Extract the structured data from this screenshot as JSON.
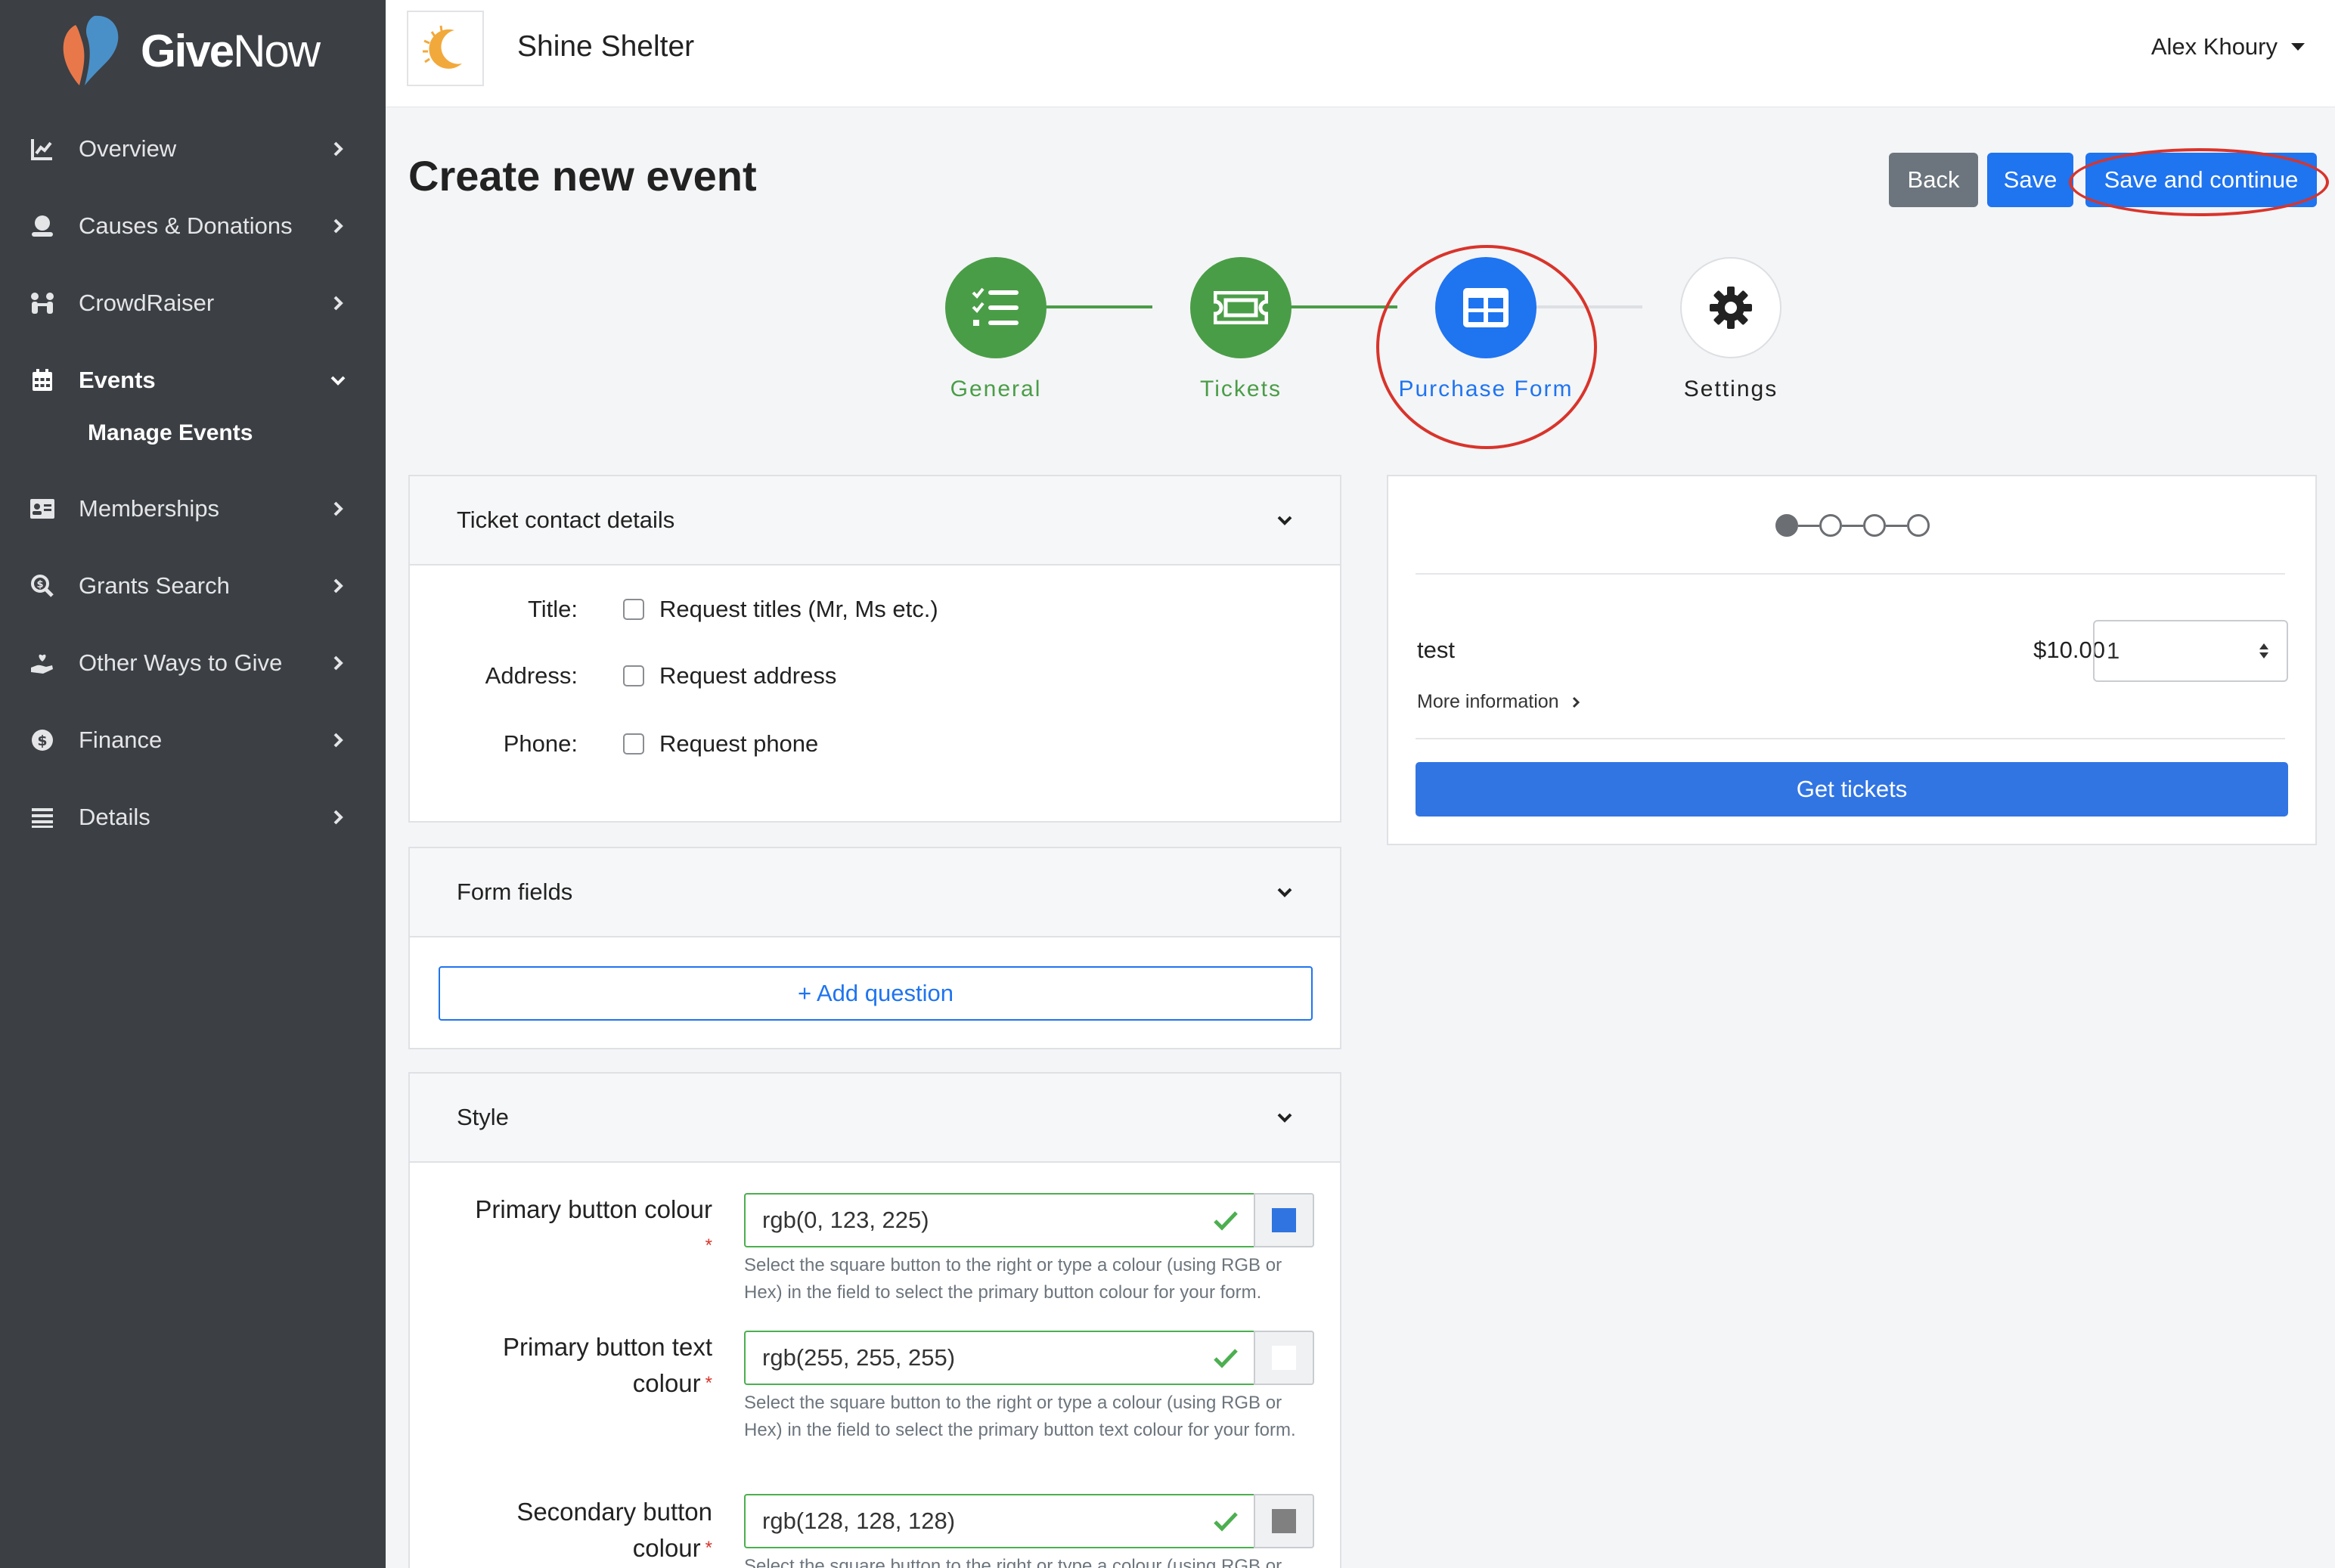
{
  "brand": {
    "logo_text_bold": "Give",
    "logo_text_light": "Now"
  },
  "sidebar": {
    "items": [
      {
        "label": "Overview",
        "icon": "chart-line-icon"
      },
      {
        "label": "Causes & Donations",
        "icon": "donation-icon"
      },
      {
        "label": "CrowdRaiser",
        "icon": "people-icon"
      },
      {
        "label": "Events",
        "icon": "calendar-icon",
        "expanded": true
      },
      {
        "label": "Memberships",
        "icon": "id-card-icon"
      },
      {
        "label": "Grants Search",
        "icon": "search-dollar-icon"
      },
      {
        "label": "Other Ways to Give",
        "icon": "hand-heart-icon"
      },
      {
        "label": "Finance",
        "icon": "dollar-gear-icon"
      },
      {
        "label": "Details",
        "icon": "list-icon"
      }
    ],
    "events_sub": "Manage Events"
  },
  "topbar": {
    "org_name": "Shine Shelter",
    "user_name": "Alex Khoury"
  },
  "page": {
    "title": "Create new event",
    "back_label": "Back",
    "save_label": "Save",
    "continue_label": "Save and continue"
  },
  "stepper": {
    "steps": [
      {
        "label": "General",
        "state": "complete",
        "icon": "checklist-icon"
      },
      {
        "label": "Tickets",
        "state": "complete",
        "icon": "ticket-icon"
      },
      {
        "label": "Purchase Form",
        "state": "active",
        "icon": "table-icon"
      },
      {
        "label": "Settings",
        "state": "pending",
        "icon": "gear-icon"
      }
    ]
  },
  "contact": {
    "header": "Ticket contact details",
    "rows": [
      {
        "label": "Title:",
        "option": "Request titles (Mr, Ms etc.)"
      },
      {
        "label": "Address:",
        "option": "Request address"
      },
      {
        "label": "Phone:",
        "option": "Request phone"
      }
    ]
  },
  "form_fields": {
    "header": "Form fields",
    "add_label": "+ Add question"
  },
  "style": {
    "header": "Style",
    "fields": [
      {
        "label_line1": "Primary button colour",
        "label_line2": "",
        "value": "rgb(0, 123, 225)",
        "swatch": "#2f74e0",
        "help": "Select the square button to the right or type a colour (using RGB or Hex) in the field to select the primary button colour for your form."
      },
      {
        "label_line1": "Primary button text",
        "label_line2": "colour",
        "value": "rgb(255, 255, 255)",
        "swatch": "#ffffff",
        "help": "Select the square button to the right or type a colour (using RGB or Hex) in the field to select the primary button text colour for your form."
      },
      {
        "label_line1": "Secondary button",
        "label_line2": "colour",
        "value": "rgb(128, 128, 128)",
        "swatch": "#808080",
        "help": "Select the square button to the right or type a colour (using RGB or"
      }
    ]
  },
  "preview": {
    "ticket_name": "test",
    "price": "$10.00",
    "quantity": "1",
    "more_info": "More information",
    "get_tickets": "Get tickets"
  },
  "colors": {
    "sidebar_bg": "#3c3f44",
    "primary": "#1f74f0",
    "complete_green": "#4a9d47",
    "annotation_red": "#d8342b"
  }
}
